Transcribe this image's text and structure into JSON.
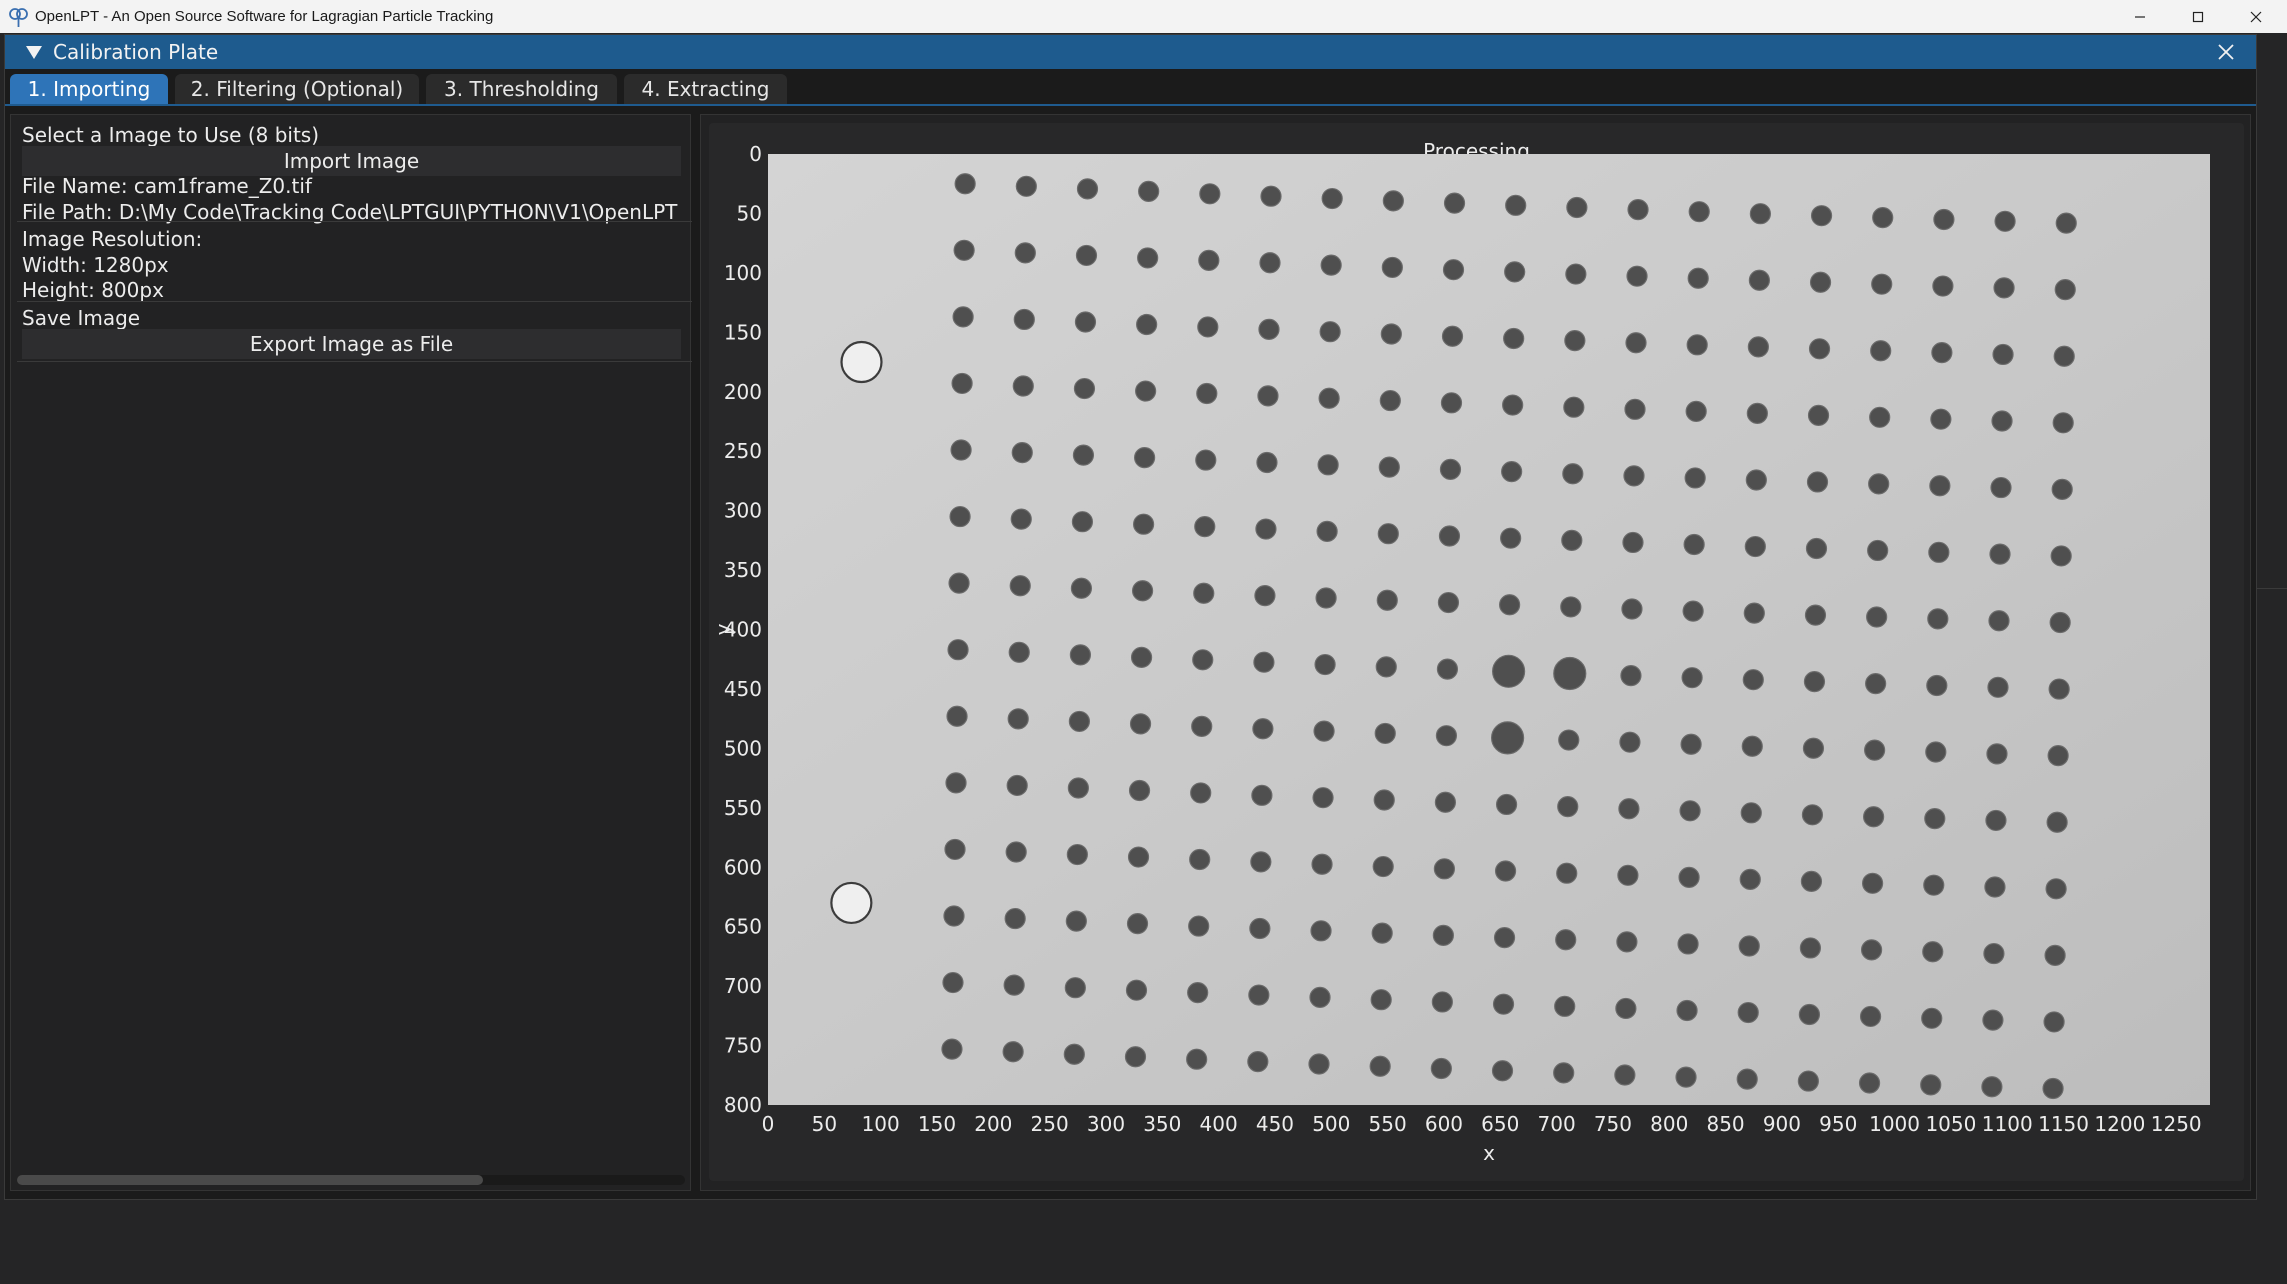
{
  "os": {
    "title": "OpenLPT - An Open Source Software for Lagragian Particle Tracking"
  },
  "window": {
    "title": "Calibration Plate"
  },
  "tabs": [
    {
      "label": "1. Importing",
      "active": true
    },
    {
      "label": "2. Filtering (Optional)",
      "active": false
    },
    {
      "label": "3. Thresholding",
      "active": false
    },
    {
      "label": "4. Extracting",
      "active": false
    }
  ],
  "left": {
    "select_label": "Select a Image to Use (8 bits)",
    "import_button": "Import Image",
    "file_name": "File Name: cam1frame_Z0.tif",
    "file_path": "File Path: D:\\My Code\\Tracking Code\\LPTGUI\\PYTHON\\V1\\OpenLPT",
    "resolution_label": "Image Resolution:",
    "width": "Width: 1280px",
    "height": "Height: 800px",
    "save_label": "Save Image",
    "export_button": "Export Image as File"
  },
  "plot": {
    "title": "Processing",
    "xlabel": "x",
    "ylabel": "y",
    "x_ticks": [
      0,
      50,
      100,
      150,
      200,
      250,
      300,
      350,
      400,
      450,
      500,
      550,
      600,
      650,
      700,
      750,
      800,
      850,
      900,
      950,
      1000,
      1050,
      1100,
      1150,
      1200,
      1250
    ],
    "y_ticks": [
      0,
      50,
      100,
      150,
      200,
      250,
      300,
      350,
      400,
      450,
      500,
      550,
      600,
      650,
      700,
      750,
      800
    ],
    "xlim": [
      0,
      1280
    ],
    "ylim": [
      0,
      800
    ],
    "colors": {
      "image_bg": "#c9c9c9",
      "dot": "#555555",
      "text": "#ececec"
    }
  }
}
